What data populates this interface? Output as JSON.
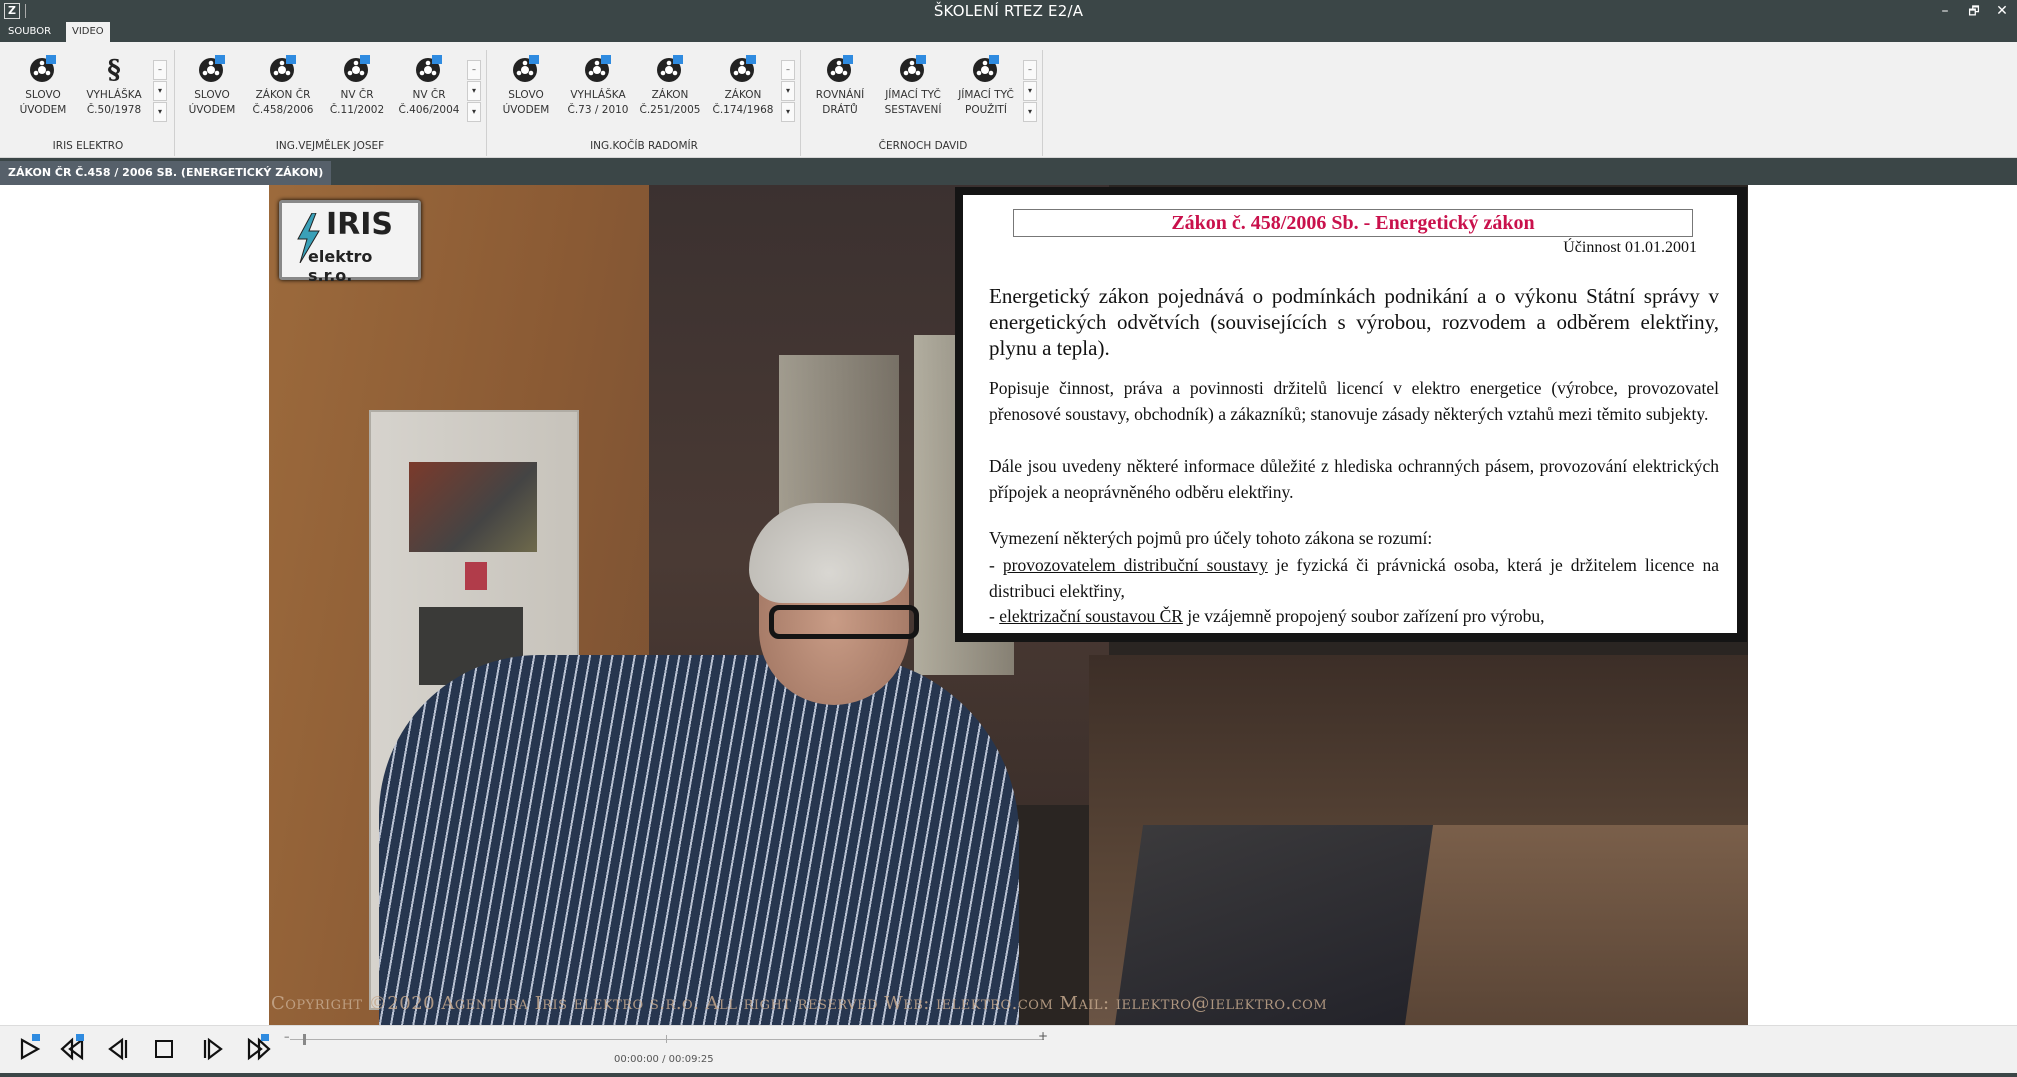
{
  "window": {
    "app_icon": "Z",
    "title": "ŠKOLENÍ RTEZ E2/A",
    "minimize": "–",
    "restore": "🗗",
    "close": "✕"
  },
  "tabs": [
    "SOUBOR",
    "VIDEO"
  ],
  "ribbon": {
    "buttons": [
      {
        "icon": "film-reel-icon",
        "label": "SLOVO\nÚVODEM"
      },
      {
        "icon": "paragraph-icon",
        "label": "VYHLÁŠKA\nČ.50/1978"
      },
      {
        "icon": "film-reel-icon",
        "label": "SLOVO\nÚVODEM"
      },
      {
        "icon": "film-reel-icon",
        "label": "ZÁKON ČR\nČ.458/2006"
      },
      {
        "icon": "film-reel-icon",
        "label": "NV ČR\nČ.11/2002"
      },
      {
        "icon": "film-reel-icon",
        "label": "NV ČR\nČ.406/2004"
      },
      {
        "icon": "film-reel-icon",
        "label": "SLOVO\nÚVODEM"
      },
      {
        "icon": "film-reel-icon",
        "label": "VYHLÁŠKA\nČ.73 / 2010"
      },
      {
        "icon": "film-reel-icon",
        "label": "ZÁKON\nČ.251/2005"
      },
      {
        "icon": "film-reel-icon",
        "label": "ZÁKON\nČ.174/1968"
      },
      {
        "icon": "film-reel-icon",
        "label": "ROVNÁNÍ\nDRÁTŮ"
      },
      {
        "icon": "film-reel-icon",
        "label": "JÍMACÍ TYČ\nSESTAVENÍ"
      },
      {
        "icon": "film-reel-icon",
        "label": "JÍMACÍ TYČ\nPOUŽITÍ"
      }
    ],
    "groups": [
      "IRIS ELEKTRO",
      "ING.VEJMĚLEK JOSEF",
      "ING.KOČÍB RADOMÍR",
      "ČERNOCH DAVID"
    ]
  },
  "status": {
    "current_video": "ZÁKON ČR Č.458 / 2006 SB. (ENERGETICKÝ ZÁKON)"
  },
  "video": {
    "logo_big": "IRIS",
    "logo_small": "elektro s.r.o.",
    "slide": {
      "title": "Zákon č. 458/2006 Sb. - Energetický zákon",
      "effective": "Účinnost 01.01.2001",
      "p1": "Energetický zákon pojednává o podmínkách podnikání a o výkonu Státní správy v energetických odvětvích (souvisejících s výrobou, rozvodem a odběrem elektřiny, plynu a tepla).",
      "p2": "Popisuje činnost, práva a povinnosti držitelů licencí v elektro energetice (výrobce, provozovatel přenosové soustavy, obchodník) a zákazníků; stanovuje zásady některých vztahů mezi těmito subjekty.",
      "p3": "Dále jsou uvedeny některé informace důležité z hlediska ochranných pásem, provozování elektrických přípojek a neoprávněného odběru elektřiny.",
      "p4": "Vymezení některých pojmů pro účely tohoto zákona se rozumí:",
      "p5_dash": "- ",
      "p5_term": "provozovatelem distribuční soustavy",
      "p5_rest": " je fyzická či právnická osoba, která je držitelem licence na distribuci elektřiny,",
      "p6_dash": "- ",
      "p6_term": "elektrizační soustavou ČR",
      "p6_rest": " je vzájemně propojený soubor zařízení pro výrobu,"
    },
    "copyright": "Copyright ©2020 Agentura Iris elektro s.r.o. All right reserved   Web: ielektro.com  Mail: ielektro@ielektro.com"
  },
  "player": {
    "buttons": [
      "play-icon",
      "rewind-start-icon",
      "step-back-icon",
      "stop-icon",
      "step-forward-icon",
      "forward-end-icon"
    ],
    "seek_minus": "–",
    "seek_plus": "+",
    "timecode": "00:00:00 / 00:09:25",
    "position_fraction": 0.02
  },
  "colors": {
    "chrome_dark": "#3b4647",
    "ribbon_bg": "#f1f1f1",
    "slide_title": "#c9114c",
    "reel_blue": "#2f8be0"
  }
}
